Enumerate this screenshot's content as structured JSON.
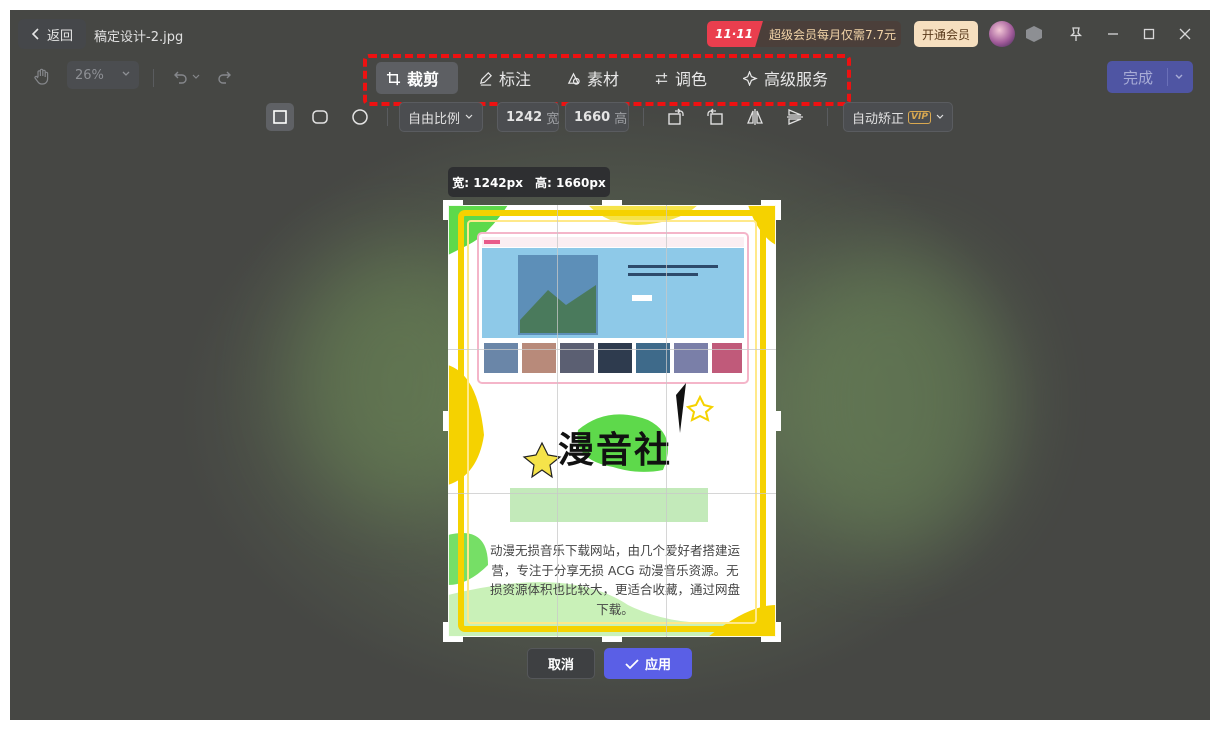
{
  "titlebar": {
    "back_label": "返回",
    "filename": "稿定设计-2.jpg",
    "promo_badge": "11·11",
    "promo_text": "超级会员每月仅需7.7元",
    "vip_button": "开通会员"
  },
  "toolbar": {
    "zoom": "26%",
    "tabs": [
      {
        "label": "裁剪",
        "icon": "crop-icon",
        "active": true
      },
      {
        "label": "标注",
        "icon": "pen-icon",
        "active": false
      },
      {
        "label": "素材",
        "icon": "material-icon",
        "active": false
      },
      {
        "label": "调色",
        "icon": "adjust-icon",
        "active": false
      },
      {
        "label": "高级服务",
        "icon": "sparkle-icon",
        "active": false
      }
    ],
    "done_label": "完成"
  },
  "crop_options": {
    "shapes": [
      "square-icon",
      "rounded-square-icon",
      "circle-icon"
    ],
    "ratio": "自由比例",
    "width": "1242",
    "width_unit": "宽",
    "height": "1660",
    "height_unit": "高",
    "auto_label": "自动矫正",
    "vip_tag": "VIP"
  },
  "dim_tooltip": {
    "width": "宽: 1242px",
    "height": "高: 1660px"
  },
  "poster": {
    "title": "漫音社",
    "description": "动漫无损音乐下载网站，由几个爱好者搭建运营，专注于分享无损 ACG 动漫音乐资源。无损资源体积也比较大，更适合收藏，通过网盘下载。"
  },
  "actions": {
    "cancel": "取消",
    "apply": "应用"
  },
  "colors": {
    "accent": "#5a5fe6",
    "highlight_box": "#ee1111",
    "poster_frame": "#f5d200",
    "poster_green": "#5ed94b"
  }
}
